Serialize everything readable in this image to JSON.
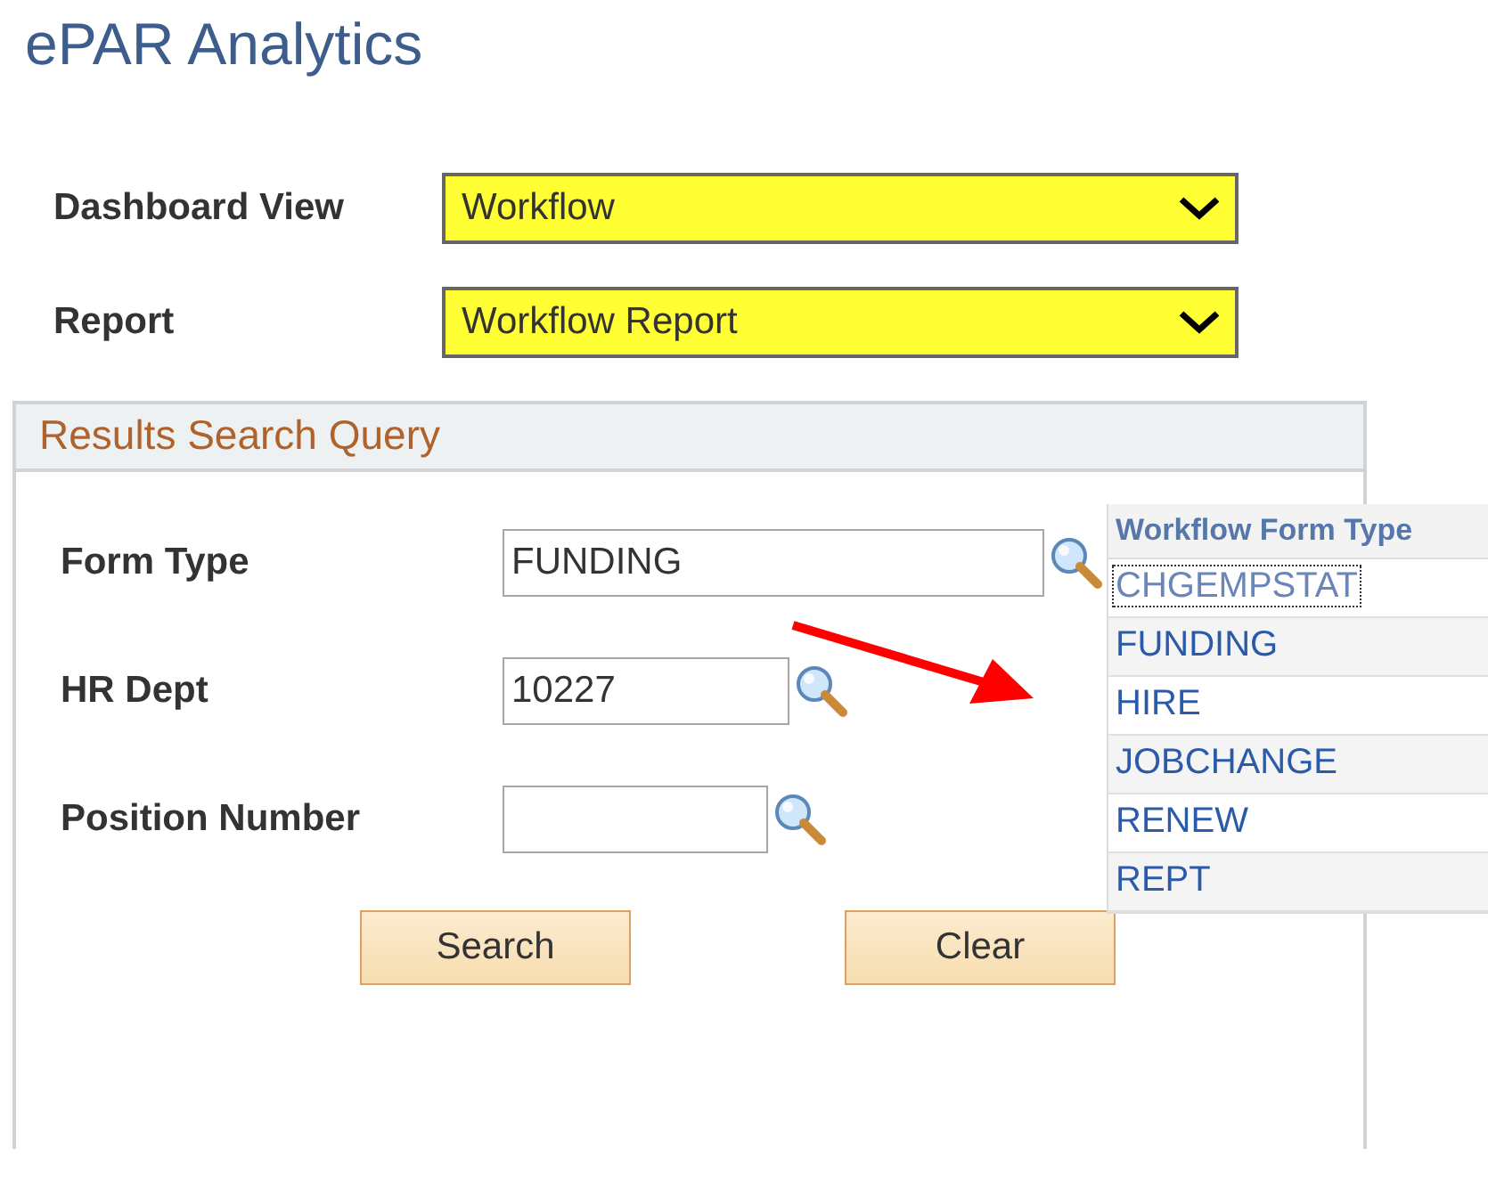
{
  "page_title": "ePAR Analytics",
  "selectors": [
    {
      "label": "Dashboard View",
      "value": "Workflow"
    },
    {
      "label": "Report",
      "value": "Workflow Report"
    }
  ],
  "panel": {
    "title": "Results Search Query",
    "fields": [
      {
        "label": "Form Type",
        "value": "FUNDING"
      },
      {
        "label": "HR Dept",
        "value": "10227"
      },
      {
        "label": "Position Number"
      }
    ],
    "buttons": [
      "Search",
      "Clear"
    ]
  },
  "lookup_list": {
    "heading": "Workflow Form Type",
    "items": [
      {
        "label": "CHGEMPSTAT",
        "focused": true
      },
      {
        "label": "FUNDING",
        "focused": false
      },
      {
        "label": "HIRE",
        "focused": false
      },
      {
        "label": "JOBCHANGE",
        "focused": false
      },
      {
        "label": "RENEW",
        "focused": false
      },
      {
        "label": "REPT",
        "focused": false
      }
    ]
  }
}
